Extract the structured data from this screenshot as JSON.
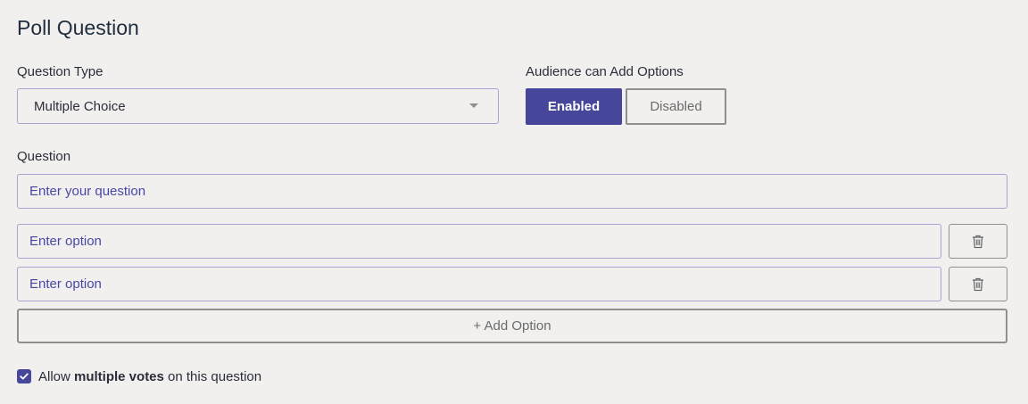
{
  "title": "Poll Question",
  "question_type": {
    "label": "Question Type",
    "selected": "Multiple Choice",
    "icon": "chevron-down-icon"
  },
  "audience": {
    "label": "Audience can Add Options",
    "enabled_label": "Enabled",
    "disabled_label": "Disabled",
    "selected": "Enabled"
  },
  "question": {
    "label": "Question",
    "placeholder": "Enter your question",
    "value": ""
  },
  "options": [
    {
      "placeholder": "Enter option",
      "value": "",
      "delete_icon": "trash-icon"
    },
    {
      "placeholder": "Enter option",
      "value": "",
      "delete_icon": "trash-icon"
    }
  ],
  "add_option_label": "+ Add Option",
  "multiple_votes": {
    "checked": true,
    "prefix": "Allow ",
    "bold": "multiple votes",
    "suffix": " on this question"
  },
  "colors": {
    "accent": "#46469a",
    "input_border": "#a9a3d3",
    "placeholder": "#4a47a3",
    "background": "#f1f0ef"
  }
}
